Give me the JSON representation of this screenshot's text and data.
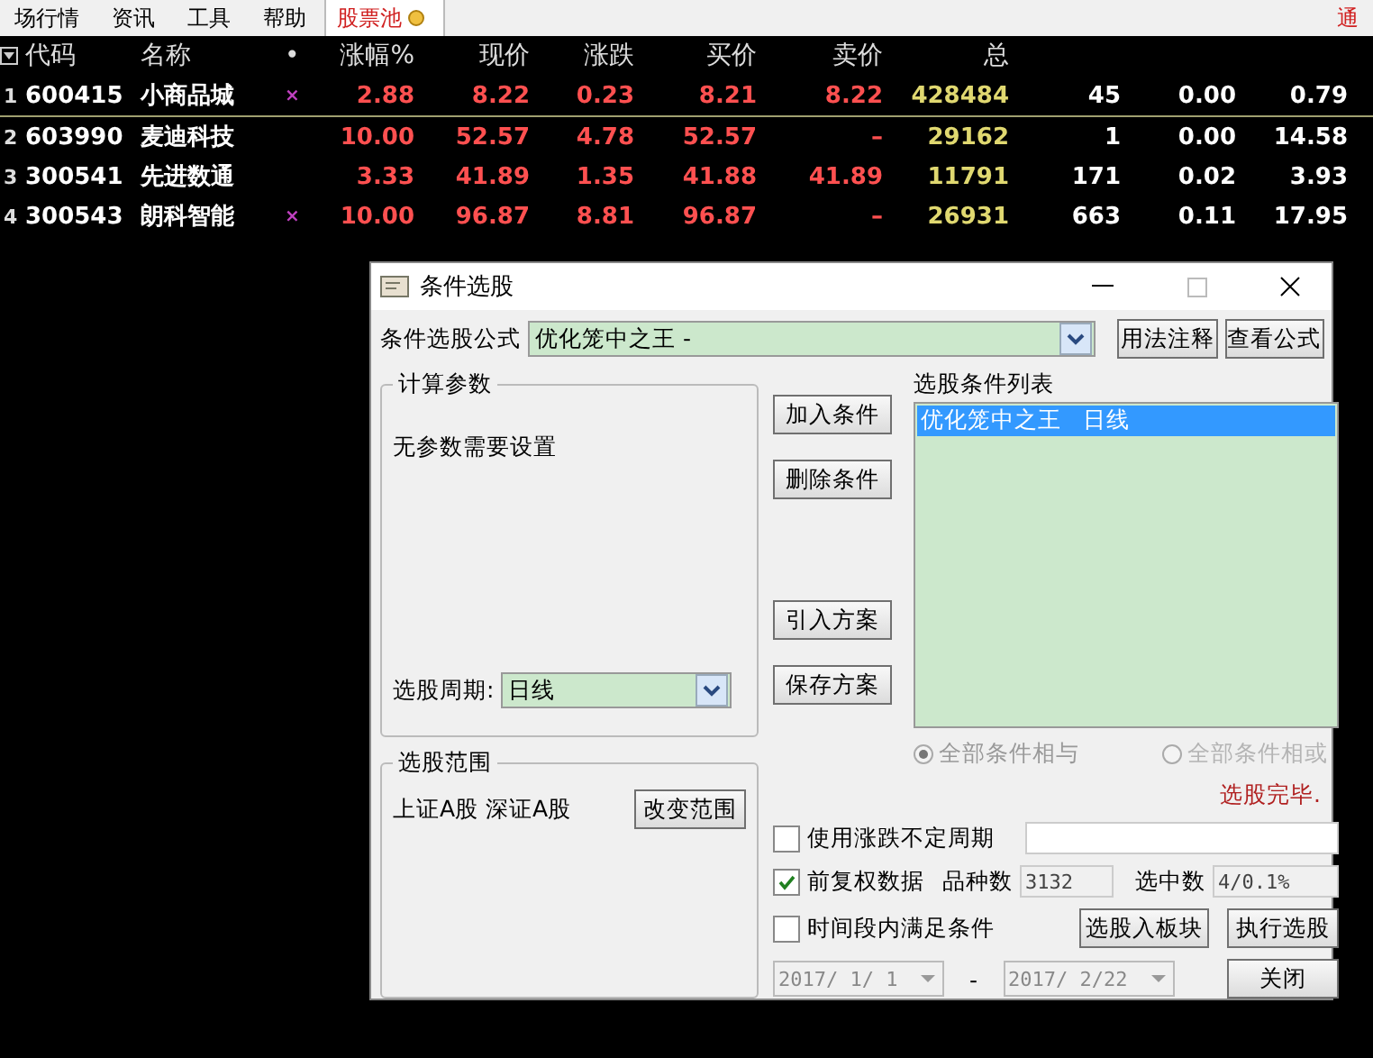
{
  "menu": [
    {
      "label": "场行情",
      "kind": "plain"
    },
    {
      "label": "资讯",
      "kind": "plain"
    },
    {
      "label": "工具",
      "kind": "plain"
    },
    {
      "label": "帮助",
      "kind": "plain"
    },
    {
      "label": "股票池",
      "kind": "pool"
    }
  ],
  "menu_right": "通",
  "table": {
    "columns": [
      "代码",
      "名称",
      "•",
      "涨幅%",
      "现价",
      "涨跌",
      "买价",
      "卖价",
      "总"
    ],
    "rows": [
      {
        "index": "1",
        "selected": true,
        "cells": [
          "600415",
          "小商品城",
          "×",
          "2.88",
          "8.22",
          "0.23",
          "8.21",
          "8.22",
          "428484",
          "45",
          "0.00",
          "0.79"
        ]
      },
      {
        "index": "2",
        "selected": false,
        "cells": [
          "603990",
          "麦迪科技",
          "",
          "10.00",
          "52.57",
          "4.78",
          "52.57",
          "–",
          "29162",
          "1",
          "0.00",
          "14.58"
        ]
      },
      {
        "index": "3",
        "selected": false,
        "cells": [
          "300541",
          "先进数通",
          "",
          "3.33",
          "41.89",
          "1.35",
          "41.88",
          "41.89",
          "11791",
          "171",
          "0.02",
          "3.93"
        ]
      },
      {
        "index": "4",
        "selected": false,
        "cells": [
          "300543",
          "朗科智能",
          "×",
          "10.00",
          "96.87",
          "8.81",
          "96.87",
          "–",
          "26931",
          "663",
          "0.11",
          "17.95"
        ]
      }
    ]
  },
  "dialog": {
    "title": "条件选股",
    "formula_label": "条件选股公式",
    "formula_value": "优化笼中之王 -",
    "buttons_top": [
      "用法注释",
      "查看公式"
    ],
    "params_title": "计算参数",
    "params_text": "无参数需要设置",
    "period_label": "选股周期:",
    "period_value": "日线",
    "middle_buttons": [
      "加入条件",
      "删除条件",
      "引入方案",
      "保存方案"
    ],
    "list_title": "选股条件列表",
    "conditions": [
      {
        "name": "优化笼中之王",
        "period": "日线",
        "selected": true
      }
    ],
    "logic": [
      {
        "label": "全部条件相与",
        "selected": true
      },
      {
        "label": "全部条件相或",
        "selected": false
      }
    ],
    "status": "选股完毕.",
    "scope_title": "选股范围",
    "scope_text": "上证A股 深证A股",
    "scope_button": "改变范围",
    "options": [
      {
        "label": "使用涨跌不定周期",
        "checked": false
      },
      {
        "label": "前复权数据",
        "checked": true
      },
      {
        "label": "时间段内满足条件",
        "checked": false
      }
    ],
    "count_label": "品种数",
    "count_value": "3132",
    "picked_label": "选中数",
    "picked_value": "4/0.1%",
    "board_button": "选股入板块",
    "run_button": "执行选股",
    "close_button": "关闭",
    "date_from": "2017/ 1/ 1",
    "date_sep": "-",
    "date_to": "2017/ 2/22"
  }
}
